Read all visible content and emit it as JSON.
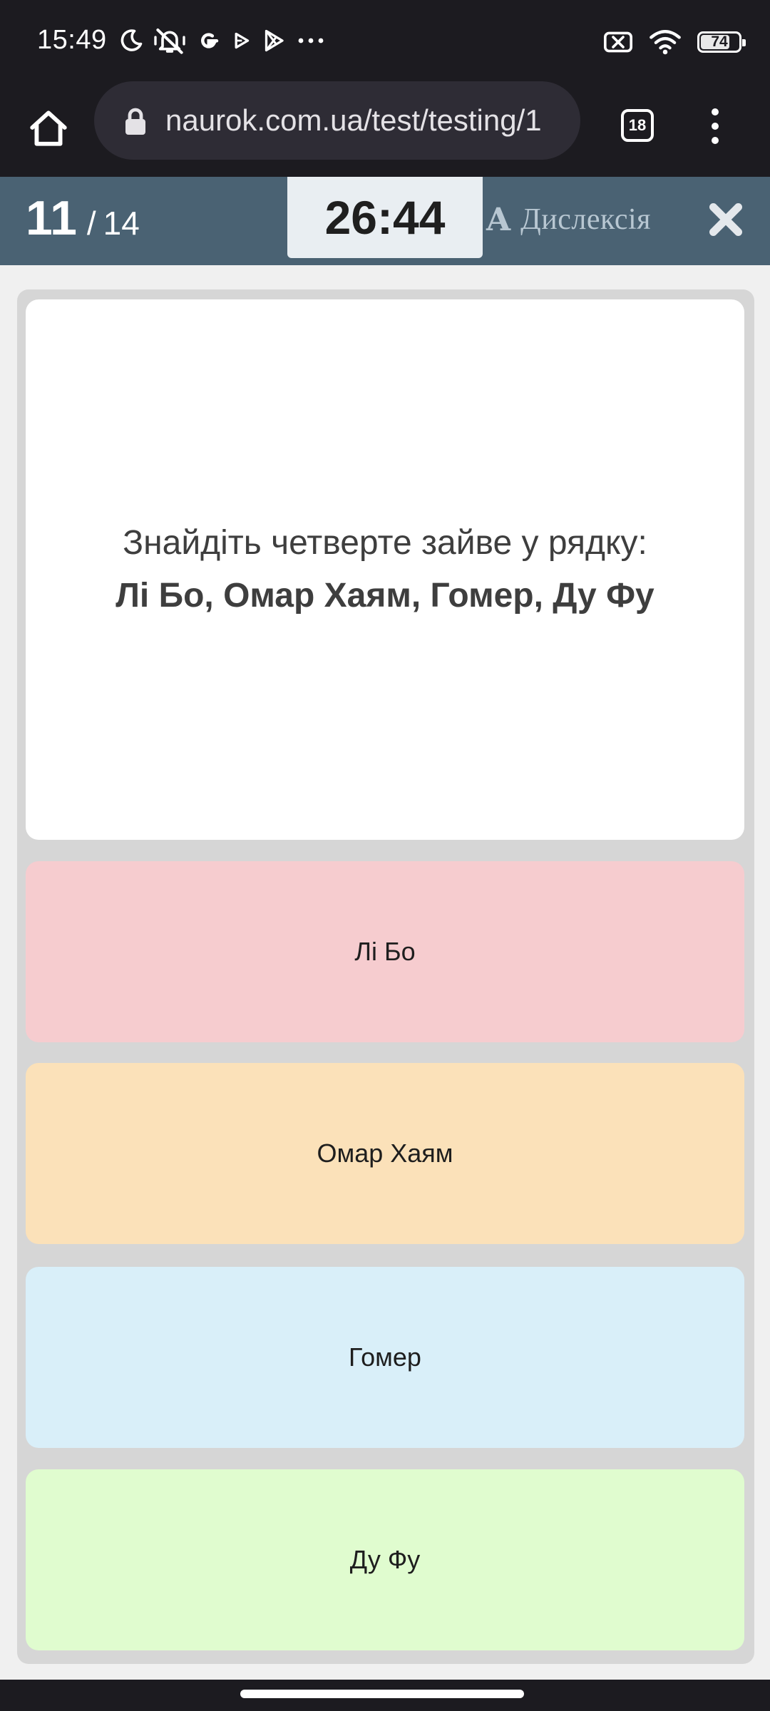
{
  "status_bar": {
    "time": "15:49",
    "battery_level": "74",
    "icons_left": [
      "moon-icon",
      "bell-off-icon",
      "google-icon",
      "play-icon",
      "play-store-icon",
      "more-dots-icon"
    ],
    "icons_right": [
      "sim-off-icon",
      "wifi-icon",
      "battery-icon"
    ]
  },
  "browser": {
    "url": "naurok.com.ua/test/testing/1",
    "tab_count": "18",
    "icons": [
      "home-icon",
      "lock-icon",
      "tabs-icon",
      "overflow-menu-icon"
    ]
  },
  "test_header": {
    "current": "11",
    "separator": "/",
    "total": "14",
    "timer": "26:44",
    "dyslexia_icon_letter": "A",
    "dyslexia_label": "Дислексія",
    "close_icon": "close-icon"
  },
  "question": {
    "line1": "Знайдіть четверте зайве у рядку:",
    "line2": "Лі Бо, Омар Хаям, Гомер, Ду Фу"
  },
  "answers": [
    {
      "label": "Лі Бо",
      "color": "#f6cccf"
    },
    {
      "label": "Омар Хаям",
      "color": "#fbe1b9"
    },
    {
      "label": "Гомер",
      "color": "#d9eff9"
    },
    {
      "label": "Ду Фу",
      "color": "#e0fccf"
    }
  ],
  "colors": {
    "system_bar": "#1c1b20",
    "header_bg": "#4a6273",
    "timer_bg": "#e9eef2",
    "panel_bg": "#d6d6d6",
    "page_bg": "#f0f0f0"
  }
}
